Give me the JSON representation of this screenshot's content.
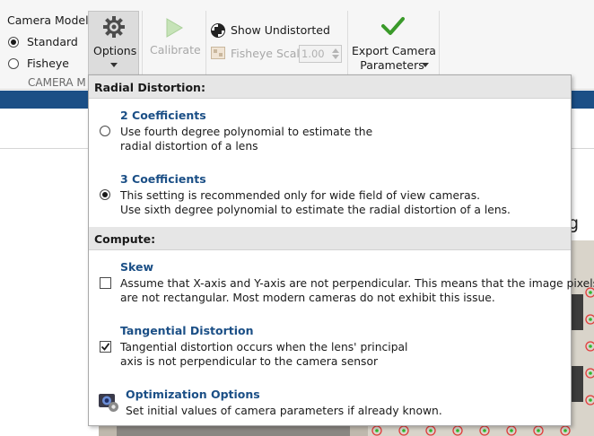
{
  "toolstrip": {
    "camera_model_label": "Camera Model:",
    "camera_models": [
      {
        "label": "Standard",
        "selected": true
      },
      {
        "label": "Fisheye",
        "selected": false
      }
    ],
    "section_label": "CAMERA M",
    "options_label": "Options",
    "options_icon": "gear-icon",
    "calibrate_label": "Calibrate",
    "calibrate_icon": "play-icon",
    "show_undistorted_label": "Show Undistorted",
    "show_undistorted_icon": "checkerboard-icon",
    "fisheye_scale_label": "Fisheye Scale",
    "fisheye_scale_value": "1.00",
    "export_label_line1": "Export Camera",
    "export_label_line2": "Parameters",
    "export_icon": "checkmark-icon",
    "accent_color": "#1b4f86",
    "export_icon_color": "#3a9a2a"
  },
  "background": {
    "partial_text": "g"
  },
  "options_panel": {
    "radial": {
      "header": "Radial Distortion:",
      "two": {
        "title": "2 Coefficients",
        "desc_line1": "Use fourth degree polynomial to estimate the",
        "desc_line2": "radial distortion of a lens",
        "selected": false
      },
      "three": {
        "title": "3 Coefficients",
        "desc_line1": "This setting is recommended only for wide field of view cameras.",
        "desc_line2": "Use sixth degree polynomial to estimate the radial distortion of a lens.",
        "selected": true
      }
    },
    "compute": {
      "header": "Compute:",
      "skew": {
        "title": "Skew",
        "desc_line1": "Assume that X-axis and Y-axis are not perpendicular. This means that the image pixels",
        "desc_line2": "are not rectangular. Most modern cameras do not exhibit this issue.",
        "checked": false
      },
      "tangential": {
        "title": "Tangential Distortion",
        "desc_line1": "Tangential distortion occurs when the lens' principal",
        "desc_line2": "axis is not perpendicular to the camera sensor",
        "checked": true
      },
      "optimization": {
        "title": "Optimization Options",
        "desc": "Set initial values of camera parameters if already known.",
        "icon": "camera-gear-icon"
      }
    }
  }
}
